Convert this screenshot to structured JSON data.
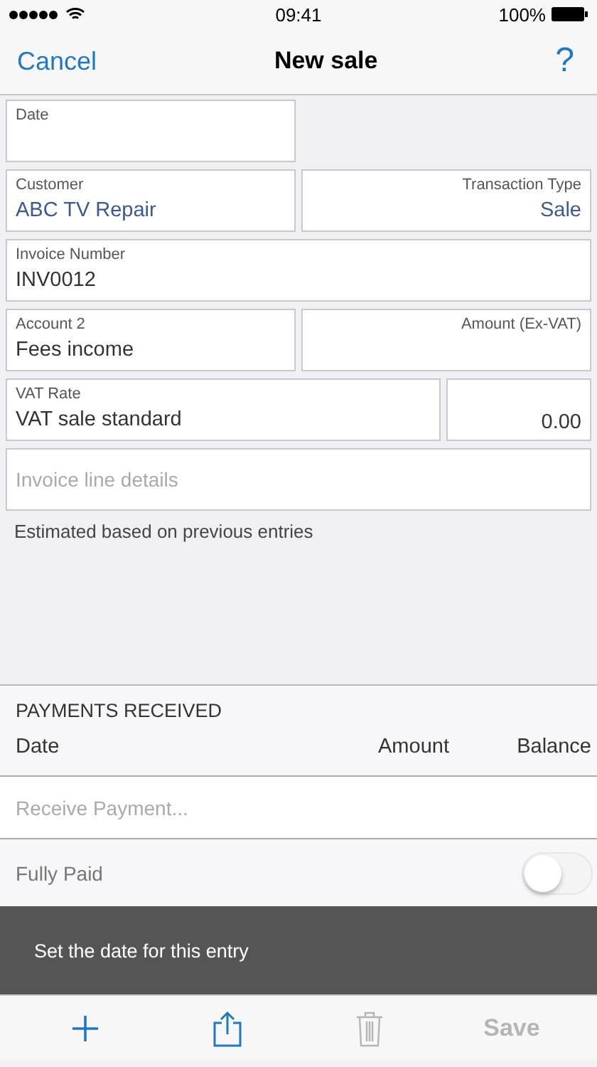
{
  "status_bar": {
    "time": "09:41",
    "battery": "100%"
  },
  "nav": {
    "cancel": "Cancel",
    "title": "New sale",
    "help": "?"
  },
  "form": {
    "rows": [
      {
        "kind": "half",
        "fields": [
          {
            "label": "Date",
            "kind": "text"
          }
        ]
      },
      {
        "kind": "pair",
        "fields": [
          {
            "label": "Customer",
            "value": "ABC TV Repair",
            "kind": "choice"
          },
          {
            "label": "Transaction Type",
            "value": "Sale",
            "kind": "selector"
          }
        ]
      },
      {
        "kind": "full",
        "fields": [
          {
            "label": "Invoice Number",
            "value": "INV0012",
            "kind": "text"
          }
        ]
      },
      {
        "kind": "pair",
        "fields": [
          {
            "label": "Account 2",
            "value": "Fees income",
            "kind": "text"
          },
          {
            "label": "Amount (Ex-VAT)",
            "kind": "amount"
          }
        ]
      },
      {
        "kind": "wide",
        "fields": [
          {
            "label": "VAT Rate",
            "value": "VAT sale standard",
            "kind": "text"
          },
          {
            "value": "0.00",
            "kind": "amount"
          }
        ]
      },
      {
        "kind": "full",
        "fields": [
          {
            "placeholder": "Invoice line details",
            "kind": "text"
          }
        ]
      }
    ],
    "note": "Estimated based on previous entries"
  },
  "payments": {
    "title": "PAYMENTS RECEIVED",
    "columns": [
      "Date",
      "Amount",
      "Balance"
    ],
    "receive_placeholder": "Receive Payment...",
    "fully_paid": {
      "label": "Fully Paid",
      "on": false
    }
  },
  "toast": "Set the date for this entry",
  "toolbar": [
    {
      "kind": "add",
      "disabled": false
    },
    {
      "kind": "share",
      "disabled": false
    },
    {
      "kind": "delete",
      "disabled": true
    },
    {
      "kind": "text",
      "label": "Save",
      "disabled": true
    }
  ]
}
